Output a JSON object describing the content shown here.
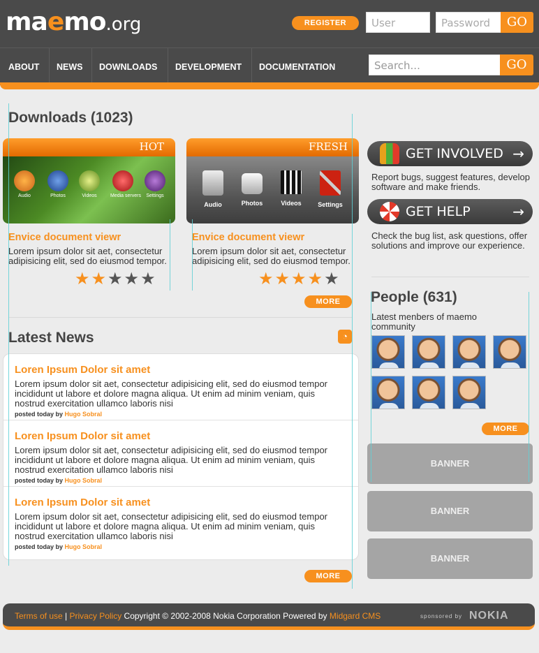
{
  "header": {
    "logo": {
      "part1": "m",
      "part2": "a",
      "part3": "e",
      "part4": "mo",
      "part5": ".org"
    },
    "register_label": "REGISTER",
    "user_placeholder": "User",
    "password_placeholder": "Password",
    "login_go": "GO",
    "search_placeholder": "Search...",
    "search_go": "GO"
  },
  "nav": {
    "items": [
      "ABOUT",
      "NEWS",
      "DOWNLOADS",
      "DEVELOPMENT",
      "DOCUMENTATION"
    ]
  },
  "downloads": {
    "heading": "Downloads (1023)",
    "cards": [
      {
        "tag": "HOT",
        "icons": [
          "Audio",
          "Photos",
          "Videos",
          "Media servers",
          "Settings"
        ],
        "title": "Envice document viewr",
        "text": "Lorem ipsum dolor sit aet, consectetur adipisicing elit, sed do eiusmod tempor.",
        "rating": 2,
        "rating_max": 5
      },
      {
        "tag": "FRESH",
        "icons": [
          "Audio",
          "Photos",
          "Videos",
          "Settings"
        ],
        "title": "Envice document viewr",
        "text": "Lorem ipsum dolor sit aet, consectetur adipisicing elit, sed do eiusmod tempor.",
        "rating": 4,
        "rating_max": 5
      }
    ],
    "more_label": "MORE"
  },
  "news": {
    "heading": "Latest News",
    "items": [
      {
        "title": "Loren Ipsum Dolor sit amet",
        "text": "Lorem ipsum dolor sit aet, consectetur adipisicing elit, sed do eiusmod tempor incididunt ut labore et dolore magna aliqua. Ut enim ad minim veniam, quis nostrud exercitation ullamco laboris nisi",
        "meta_prefix": "posted today by",
        "author": "Hugo Sobral"
      },
      {
        "title": "Loren Ipsum Dolor sit amet",
        "text": "Lorem ipsum dolor sit aet, consectetur adipisicing elit, sed do eiusmod tempor incididunt ut labore et dolore magna aliqua. Ut enim ad minim veniam, quis nostrud exercitation ullamco laboris nisi",
        "meta_prefix": "posted today by",
        "author": "Hugo Sobral"
      },
      {
        "title": "Loren Ipsum Dolor sit amet",
        "text": "Lorem ipsum dolor sit aet, consectetur adipisicing elit, sed do eiusmod tempor incididunt ut labore et dolore magna aliqua. Ut enim ad minim veniam, quis nostrud exercitation ullamco laboris nisi",
        "meta_prefix": "posted today by",
        "author": "Hugo Sobral"
      }
    ],
    "more_label": "MORE"
  },
  "sidebar": {
    "get_involved": {
      "label": "GET INVOLVED",
      "text": "Report bugs, suggest features, develop software and make friends."
    },
    "get_help": {
      "label": "GET HELP",
      "text": "Check the bug list, ask questions, offer solutions and improve our experience."
    },
    "people": {
      "heading": "People (631)",
      "subtitle": "Latest menbers of maemo community",
      "count": 7,
      "more_label": "MORE"
    },
    "banners": [
      "BANNER",
      "BANNER",
      "BANNER"
    ]
  },
  "footer": {
    "terms": "Terms of use",
    "divider": "|",
    "privacy": "Privacy Policy",
    "copyright": "Copyright © 2002-2008 Nokia Corporation Powered by",
    "cms": "Midgard CMS",
    "sponsored": "sponsored by",
    "sponsor_name": "NOKIA"
  },
  "colors": {
    "accent": "#f7901e",
    "dark": "#4a4a4a",
    "banner": "#a5a5a5"
  }
}
